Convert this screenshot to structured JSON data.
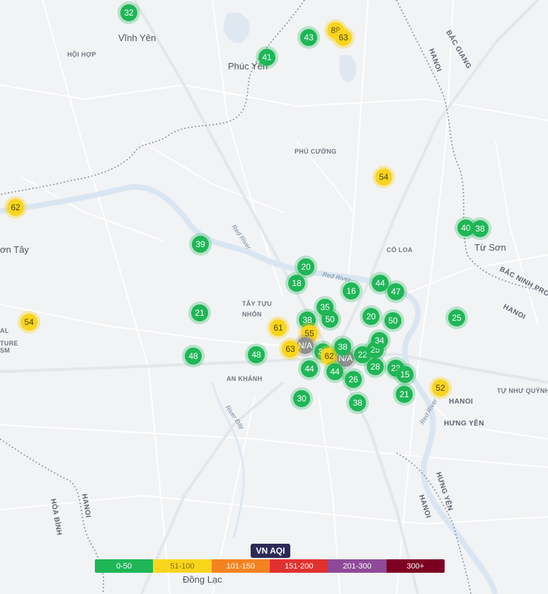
{
  "map_labels": {
    "vinh_yen": "Vĩnh Yên",
    "hoi_hop": "HỘI HỢP",
    "phuc_yen": "Phúc Yên",
    "bac_giang": "BẮC GIANG",
    "hanoi_ne": "HANOI",
    "phu_cuong": "PHÚ CƯỜNG",
    "son_tay": "ơn Tây",
    "co_loa": "CỔ LOA",
    "tu_son": "Từ Sơn",
    "bac_ninh": "BẮC NINH PROVI",
    "hanoi_e": "HANOI",
    "tay_tuu": "TÂY TỰU",
    "nhon": "NHỔN",
    "an_khanh": "AN KHÁNH",
    "tu_nhu_quynh": "TỰ NHƯ QUỲNH",
    "hanoi_se": "HANOI",
    "hung_yen": "HƯNG YÊN",
    "hung_yen_v": "HƯNG YÊN",
    "hanoi_s": "HANOI",
    "hoa_binh": "HÒA BÌNH",
    "hanoi_w": "HANOI",
    "dong_lac": "Đồng Lạc",
    "red_river_1": "Red River",
    "red_river_2": "Red River",
    "red_river_3": "Red River",
    "river_day": "River Đáy",
    "museum_a": "AL",
    "museum_b": "TURE",
    "museum_c": "SM"
  },
  "markers": [
    {
      "value": "32",
      "level": "good"
    },
    {
      "value": "43",
      "level": "good"
    },
    {
      "value": "88",
      "level": "moderate"
    },
    {
      "value": "63",
      "level": "moderate"
    },
    {
      "value": "41",
      "level": "good"
    },
    {
      "value": "54",
      "level": "moderate"
    },
    {
      "value": "62",
      "level": "moderate"
    },
    {
      "value": "40",
      "level": "good"
    },
    {
      "value": "38",
      "level": "good"
    },
    {
      "value": "39",
      "level": "good"
    },
    {
      "value": "20",
      "level": "good"
    },
    {
      "value": "18",
      "level": "good"
    },
    {
      "value": "16",
      "level": "good"
    },
    {
      "value": "44",
      "level": "good"
    },
    {
      "value": "47",
      "level": "good"
    },
    {
      "value": "21",
      "level": "good"
    },
    {
      "value": "35",
      "level": "good"
    },
    {
      "value": "38",
      "level": "good"
    },
    {
      "value": "50",
      "level": "good"
    },
    {
      "value": "20",
      "level": "good"
    },
    {
      "value": "50",
      "level": "good"
    },
    {
      "value": "25",
      "level": "good"
    },
    {
      "value": "54",
      "level": "moderate"
    },
    {
      "value": "61",
      "level": "moderate"
    },
    {
      "value": "55",
      "level": "moderate"
    },
    {
      "value": "N/A",
      "level": "na"
    },
    {
      "value": "63",
      "level": "moderate"
    },
    {
      "value": "35",
      "level": "good"
    },
    {
      "value": "48",
      "level": "good"
    },
    {
      "value": "48",
      "level": "good"
    },
    {
      "value": "62",
      "level": "moderate"
    },
    {
      "value": "N/A",
      "level": "na"
    },
    {
      "value": "38",
      "level": "good"
    },
    {
      "value": "22",
      "level": "good"
    },
    {
      "value": "25",
      "level": "good"
    },
    {
      "value": "34",
      "level": "good"
    },
    {
      "value": "44",
      "level": "good"
    },
    {
      "value": "44",
      "level": "good"
    },
    {
      "value": "26",
      "level": "good"
    },
    {
      "value": "28",
      "level": "good"
    },
    {
      "value": "23",
      "level": "good"
    },
    {
      "value": "15",
      "level": "good"
    },
    {
      "value": "21",
      "level": "good"
    },
    {
      "value": "52",
      "level": "moderate"
    },
    {
      "value": "30",
      "level": "good"
    },
    {
      "value": "38",
      "level": "good"
    }
  ],
  "legend": {
    "title": "VN AQI",
    "segments": [
      {
        "label": "0-50",
        "color": "#1fb656",
        "text_color": "#ffffff"
      },
      {
        "label": "51-100",
        "color": "#f9d51c",
        "text_color": "#8a7400"
      },
      {
        "label": "101-150",
        "color": "#f58220",
        "text_color": "#ffffff"
      },
      {
        "label": "151-200",
        "color": "#e0312f",
        "text_color": "#ffffff"
      },
      {
        "label": "201-300",
        "color": "#8e4a98",
        "text_color": "#ffffff"
      },
      {
        "label": "300+",
        "color": "#7d0022",
        "text_color": "#ffffff"
      }
    ]
  }
}
